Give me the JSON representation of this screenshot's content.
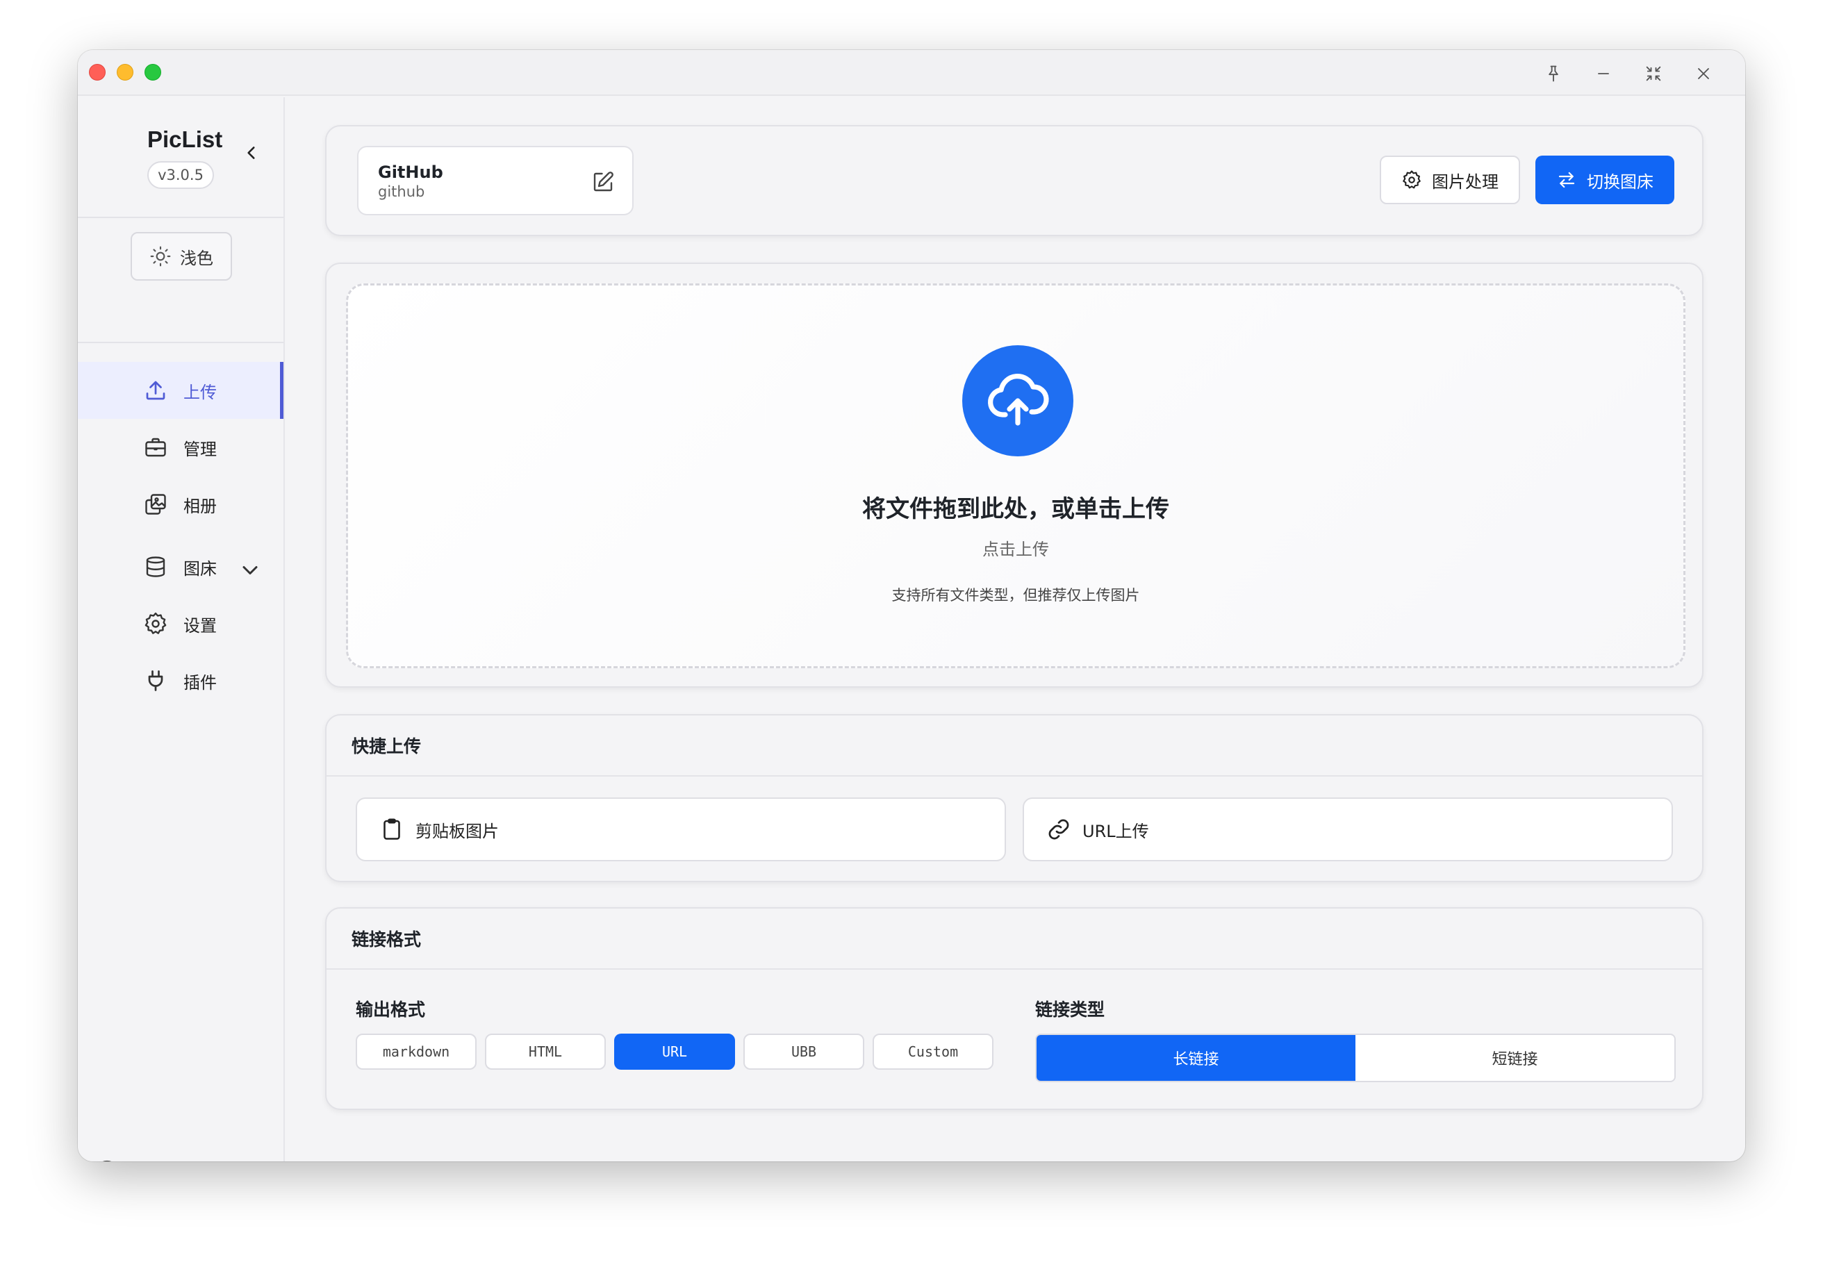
{
  "app": {
    "title": "PicList",
    "version": "v3.0.5"
  },
  "theme": {
    "label": "浅色"
  },
  "nav": {
    "items": [
      {
        "label": "上传",
        "icon": "upload-icon",
        "active": true
      },
      {
        "label": "管理",
        "icon": "briefcase-icon"
      },
      {
        "label": "相册",
        "icon": "gallery-icon"
      },
      {
        "label": "图床",
        "icon": "database-icon"
      },
      {
        "label": "设置",
        "icon": "gear-icon"
      },
      {
        "label": "插件",
        "icon": "plug-icon"
      }
    ]
  },
  "provider": {
    "name": "GitHub",
    "id": "github"
  },
  "toolbar": {
    "image_process": "图片处理",
    "switch_bed": "切换图床"
  },
  "dropzone": {
    "title": "将文件拖到此处，或单击上传",
    "subtitle": "点击上传",
    "hint": "支持所有文件类型，但推荐仅上传图片"
  },
  "quick_upload": {
    "title": "快捷上传",
    "clipboard": "剪贴板图片",
    "url": "URL上传"
  },
  "link_format": {
    "title": "链接格式",
    "output_label": "输出格式",
    "formats": [
      "markdown",
      "HTML",
      "URL",
      "UBB",
      "Custom"
    ],
    "selected_format": "URL",
    "type_label": "链接类型",
    "types": [
      "长链接",
      "短链接"
    ],
    "selected_type": "长链接"
  },
  "colors": {
    "accent": "#1166f5",
    "nav_active": "#4f5bd5",
    "upload_circle": "#1f6ff2"
  }
}
